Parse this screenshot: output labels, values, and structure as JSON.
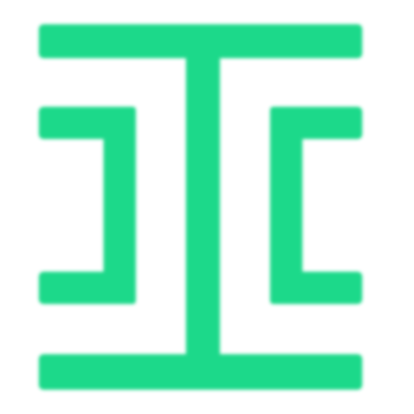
{
  "icon": {
    "name": "text-cursor-icon",
    "color": "#1ED98A",
    "background": "#FFFFFF"
  }
}
